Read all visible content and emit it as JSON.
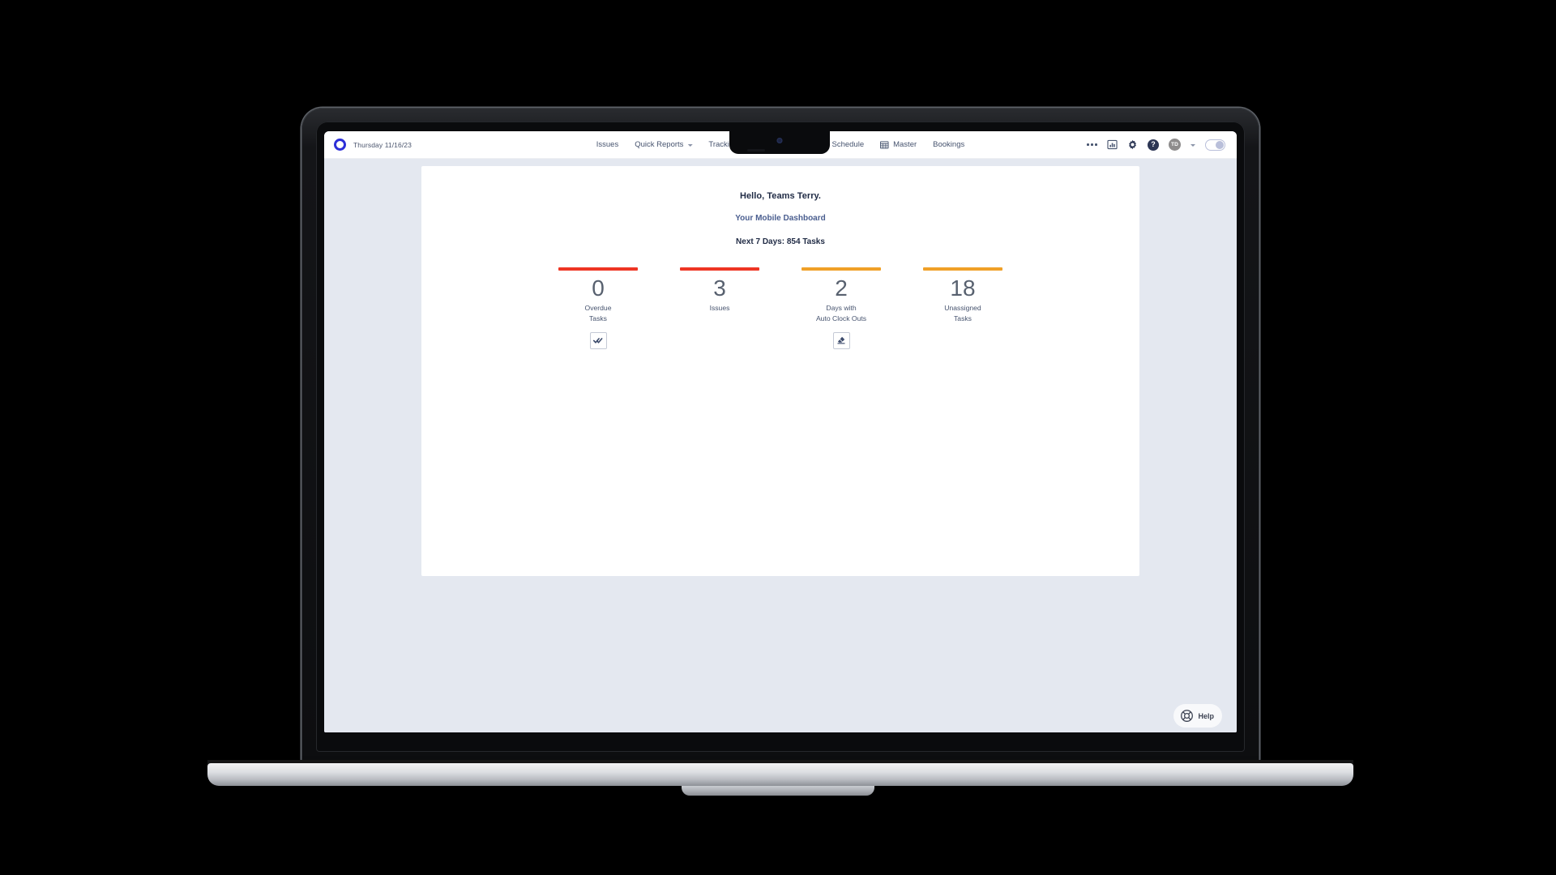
{
  "navbar": {
    "logo_icon": "ring-logo-icon",
    "date": "Thursday  11/16/23",
    "items": [
      {
        "label": "Issues",
        "icon": null,
        "caret": false
      },
      {
        "label": "Quick Reports",
        "icon": null,
        "caret": true
      },
      {
        "label": "Tracking",
        "icon": null,
        "caret": false
      },
      {
        "label": "Schedule",
        "icon": null,
        "caret": false
      },
      {
        "label": "Master",
        "icon": "calendar-icon",
        "caret": false
      },
      {
        "label": "Bookings",
        "icon": null,
        "caret": false
      }
    ],
    "right": {
      "more_icon": "ellipsis-icon",
      "reports_icon": "bar-chart-icon",
      "settings_icon": "gear-icon",
      "help_icon": "question-mark-icon",
      "help_glyph": "?",
      "avatar_initials": "TD",
      "avatar_caret_icon": "chevron-down-icon",
      "toggle_icon": "toggle-switch",
      "toggle_state": "on"
    }
  },
  "dashboard": {
    "greeting": "Hello, Teams Terry.",
    "subtitle": "Your Mobile Dashboard",
    "next_days": "Next 7 Days: 854 Tasks",
    "stats": [
      {
        "value": "0",
        "label_line1": "Overdue",
        "label_line2": "Tasks",
        "bar_color": "#ee3524",
        "action_icon": "double-check-icon",
        "has_action": true
      },
      {
        "value": "3",
        "label_line1": "Issues",
        "label_line2": "",
        "bar_color": "#ee3524",
        "action_icon": null,
        "has_action": false
      },
      {
        "value": "2",
        "label_line1": "Days with",
        "label_line2": "Auto Clock Outs",
        "bar_color": "#f0a028",
        "action_icon": "eraser-icon",
        "has_action": true
      },
      {
        "value": "18",
        "label_line1": "Unassigned",
        "label_line2": "Tasks",
        "bar_color": "#f0a028",
        "action_icon": null,
        "has_action": false
      }
    ]
  },
  "help_widget": {
    "label": "Help",
    "icon": "lifebuoy-icon"
  },
  "colors": {
    "accent_red": "#ee3524",
    "accent_orange": "#f0a028",
    "brand_blue": "#2d2fd8",
    "page_bg": "#e4e8f0",
    "text_dark": "#1f2a44",
    "text_muted": "#46536e",
    "subtitle_blue": "#4a5e8f"
  }
}
